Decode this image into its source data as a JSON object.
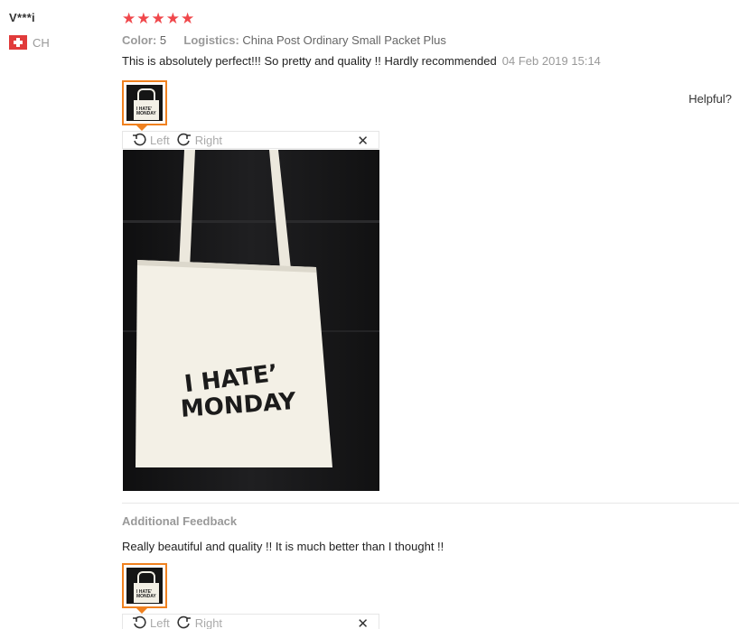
{
  "review": {
    "user_name": "V***i",
    "country_code": "CH",
    "rating_stars": "★★★★★",
    "rating_value": 5,
    "color_label": "Color:",
    "color_value": "5",
    "logistics_label": "Logistics:",
    "logistics_value": "China Post Ordinary Small Packet Plus",
    "feedback_text": "This is absolutely perfect!!! So pretty and quality !! Hardly recommended",
    "date": "04 Feb 2019 15:14",
    "helpful_label": "Helpful?",
    "star_color": "#f0474b",
    "accent_color": "#f0811f"
  },
  "viewer": {
    "left_label": "Left",
    "right_label": "Right",
    "close_glyph": "✕",
    "photo_text_line1": "I HATE’",
    "photo_text_line2": "MONDAY",
    "thumb_text_line1": "I HATE’",
    "thumb_text_line2": "MONDAY"
  },
  "additional": {
    "title": "Additional Feedback",
    "text": "Really beautiful and quality !! It is much better than I thought !!",
    "left_label": "Left",
    "right_label": "Right",
    "close_glyph": "✕"
  }
}
